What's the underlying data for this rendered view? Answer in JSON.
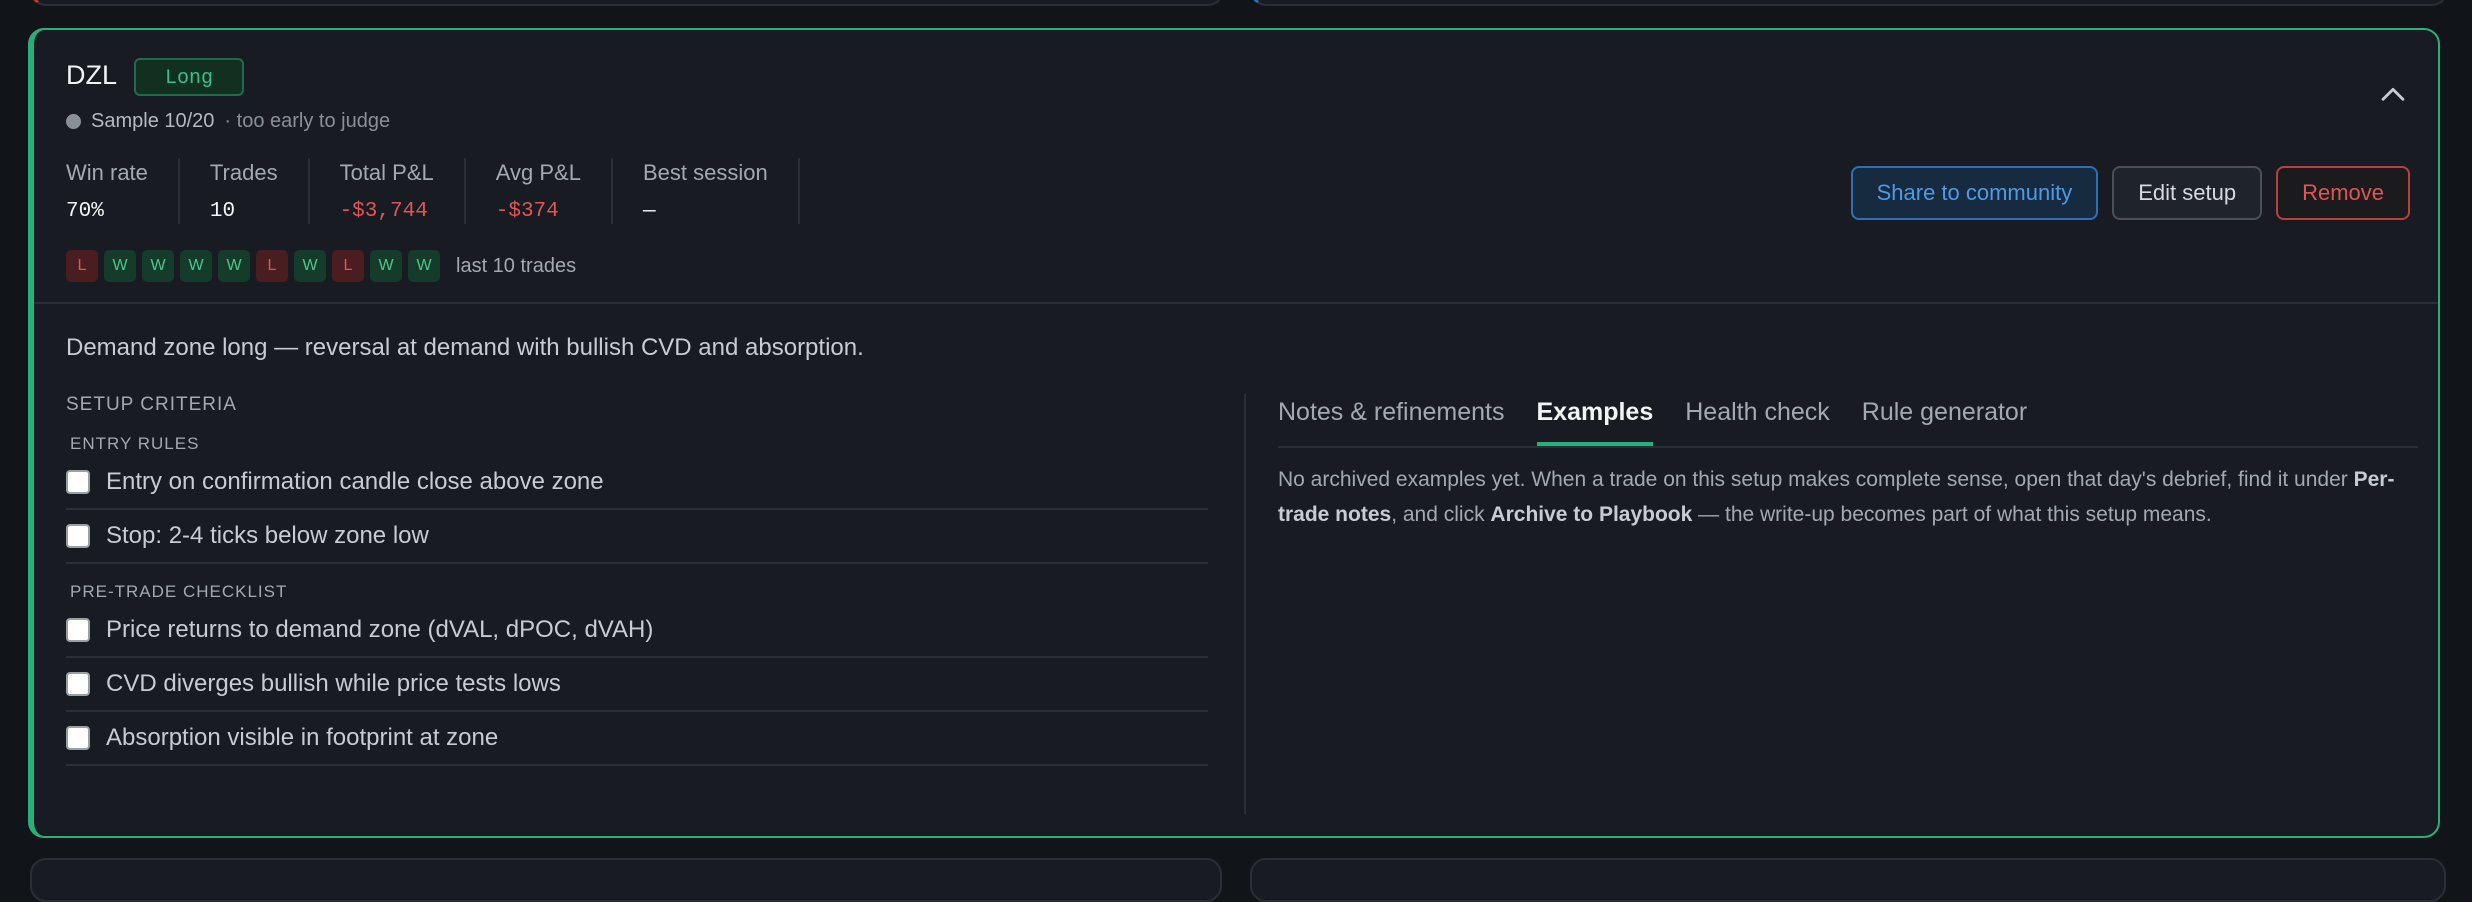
{
  "setup": {
    "ticker": "DZL",
    "side": "Long",
    "sample": "Sample 10/20",
    "sample_note": "· too early to judge",
    "accent_color": "#27b07a"
  },
  "stats": [
    {
      "label": "Win rate",
      "value": "70%",
      "tone": "neutral"
    },
    {
      "label": "Trades",
      "value": "10",
      "tone": "neutral"
    },
    {
      "label": "Total P&L",
      "value": "-$3,744",
      "tone": "negative"
    },
    {
      "label": "Avg P&L",
      "value": "-$374",
      "tone": "negative"
    },
    {
      "label": "Best session",
      "value": "—",
      "tone": "neutral"
    }
  ],
  "actions": {
    "share": "Share to community",
    "edit": "Edit setup",
    "remove": "Remove"
  },
  "recent_trades": [
    "L",
    "W",
    "W",
    "W",
    "W",
    "L",
    "W",
    "L",
    "W",
    "W"
  ],
  "recent_trades_label": "last 10 trades",
  "description": "Demand zone long — reversal at demand with bullish CVD and absorption.",
  "criteria": {
    "title": "SETUP CRITERIA",
    "entry_title": "ENTRY RULES",
    "entry_rules": [
      "Entry on confirmation candle close above zone",
      "Stop: 2-4 ticks below zone low"
    ],
    "checklist_title": "PRE-TRADE CHECKLIST",
    "checklist": [
      "Price returns to demand zone (dVAL, dPOC, dVAH)",
      "CVD diverges bullish while price tests lows",
      "Absorption visible in footprint at zone"
    ]
  },
  "tabs": [
    {
      "label": "Notes & refinements",
      "active": false
    },
    {
      "label": "Examples",
      "active": true
    },
    {
      "label": "Health check",
      "active": false
    },
    {
      "label": "Rule generator",
      "active": false
    }
  ],
  "examples": {
    "text_1": "No archived examples yet. When a trade on this setup makes complete sense, open that day's debrief, find it under ",
    "bold_1": "Per-trade notes",
    "text_2": ", and click ",
    "bold_2": "Archive to Playbook",
    "text_3": " — the write-up becomes part of what this setup means."
  },
  "icons": {
    "collapse": "chevron-up-icon",
    "sample": "status-dot-icon"
  }
}
